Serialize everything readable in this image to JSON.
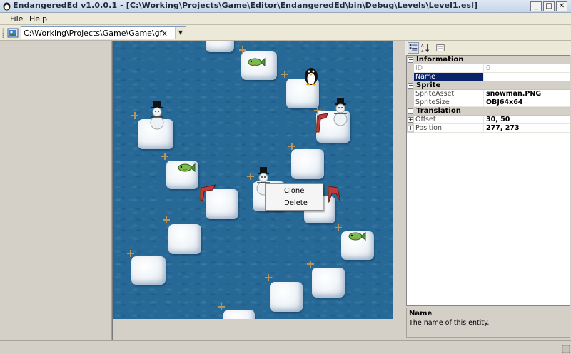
{
  "window": {
    "title": "EndangeredEd v1.0.0.1 - [C:\\Working\\Projects\\Game\\Editor\\EndangeredEd\\bin\\Debug\\Levels\\Level1.esl]",
    "minimize_glyph": "_",
    "maximize_glyph": "□",
    "close_glyph": "✕"
  },
  "menu": {
    "file": "File",
    "help": "Help"
  },
  "toolbar": {
    "path": "C:\\Working\\Projects\\Game\\Game\\gfx",
    "dropdown_glyph": "▼"
  },
  "context_menu": {
    "clone": "Clone",
    "delete": "Delete"
  },
  "property_grid": {
    "categories": {
      "information": "Information",
      "sprite": "Sprite",
      "translation": "Translation"
    },
    "rows": {
      "id": {
        "name": "ID",
        "value": "0"
      },
      "name": {
        "name": "Name",
        "value": ""
      },
      "sprite_asset": {
        "name": "SpriteAsset",
        "value": "snowman.PNG"
      },
      "sprite_size": {
        "name": "SpriteSize",
        "value": "OBJ64x64"
      },
      "offset": {
        "name": "Offset",
        "value": "30, 50"
      },
      "position": {
        "name": "Position",
        "value": "277, 273"
      }
    },
    "collapse_glyph": "−",
    "expand_glyph": "+"
  },
  "description": {
    "title": "Name",
    "text": "The name of this entity."
  },
  "colors": {
    "water": "#266896",
    "selection": "#0a246a",
    "marker": "#b8955c"
  },
  "icons": [
    "app-icon",
    "open-folder-icon",
    "categorized-icon",
    "alphabetical-icon",
    "property-pages-icon",
    "snowman-icon",
    "penguin-icon",
    "fish-icon",
    "seal-icon"
  ]
}
